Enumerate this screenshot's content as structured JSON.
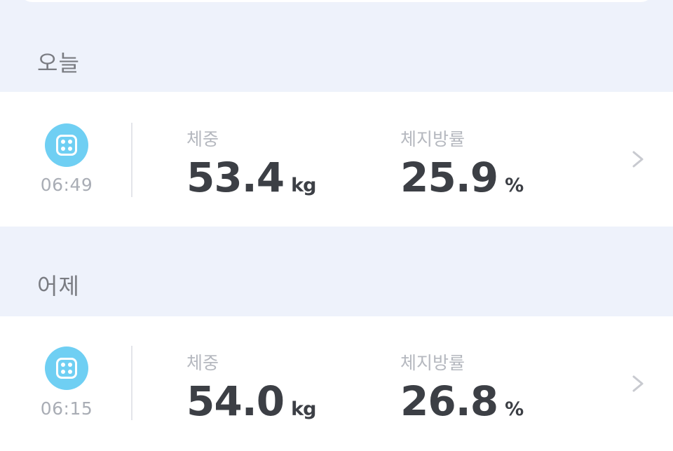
{
  "sections": [
    {
      "title": "오늘",
      "record": {
        "time": "06:49",
        "weight_label": "체중",
        "weight_value": "53.4",
        "weight_unit": "kg",
        "fat_label": "체지방률",
        "fat_value": "25.9",
        "fat_unit": "%"
      }
    },
    {
      "title": "어제",
      "record": {
        "time": "06:15",
        "weight_label": "체중",
        "weight_value": "54.0",
        "weight_unit": "kg",
        "fat_label": "체지방률",
        "fat_value": "26.8",
        "fat_unit": "%"
      }
    }
  ],
  "icons": {
    "record": "scale-icon",
    "navigate": "chevron-right-icon"
  },
  "colors": {
    "background": "#eef2fb",
    "icon_accent": "#6fcff3",
    "value_text": "#3c3f45",
    "label_text": "#b5b8bf"
  }
}
